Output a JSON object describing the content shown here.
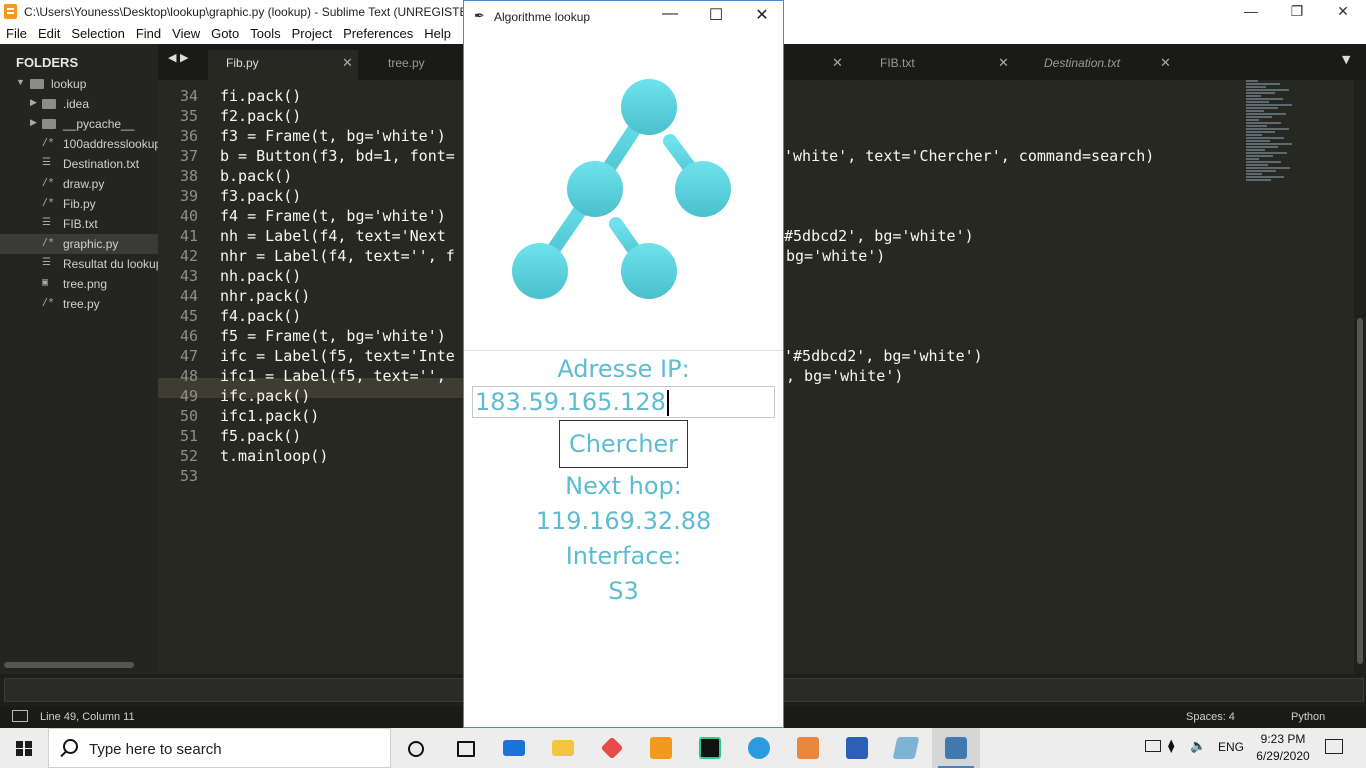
{
  "sublime": {
    "title": "C:\\Users\\Youness\\Desktop\\lookup\\graphic.py (lookup) - Sublime Text (UNREGISTERED)",
    "menu": [
      "File",
      "Edit",
      "Selection",
      "Find",
      "View",
      "Goto",
      "Tools",
      "Project",
      "Preferences",
      "Help"
    ],
    "sidebar_header": "FOLDERS",
    "tree": [
      {
        "label": "lookup",
        "kind": "folder-open"
      },
      {
        "label": ".idea",
        "kind": "folder"
      },
      {
        "label": "__pycache__",
        "kind": "folder"
      },
      {
        "label": "100addresslookup",
        "kind": "code",
        "glyph": "/*"
      },
      {
        "label": "Destination.txt",
        "kind": "text",
        "glyph": "☰"
      },
      {
        "label": "draw.py",
        "kind": "code",
        "glyph": "/*"
      },
      {
        "label": "Fib.py",
        "kind": "code",
        "glyph": "/*"
      },
      {
        "label": "FIB.txt",
        "kind": "text",
        "glyph": "☰"
      },
      {
        "label": "graphic.py",
        "kind": "code",
        "glyph": "/*",
        "selected": true
      },
      {
        "label": "Resultat du lookup",
        "kind": "text",
        "glyph": "☰"
      },
      {
        "label": "tree.png",
        "kind": "image",
        "glyph": "▣"
      },
      {
        "label": "tree.py",
        "kind": "code",
        "glyph": "/*"
      }
    ],
    "tabs": [
      {
        "label": "Fib.py"
      },
      {
        "label": "tree.py"
      },
      {
        "label": "FIB.txt"
      },
      {
        "label": "Destination.txt",
        "italic": true
      }
    ],
    "line_numbers": [
      "34",
      "35",
      "36",
      "37",
      "38",
      "39",
      "40",
      "41",
      "42",
      "43",
      "44",
      "45",
      "46",
      "47",
      "48",
      "49",
      "50",
      "51",
      "52",
      "53"
    ],
    "code": [
      "fi.pack()",
      "f2.pack()",
      "f3 = Frame(t, bg='white')",
      "b = Button(f3, bd=1, font=",
      "b.pack()",
      "f3.pack()",
      "f4 = Frame(t, bg='white')",
      "nh = Label(f4, text='Next",
      "nhr = Label(f4, text='', f",
      "nh.pack()",
      "nhr.pack()",
      "f4.pack()",
      "f5 = Frame(t, bg='white')",
      "ifc = Label(f5, text='Inte",
      "ifc1 = Label(f5, text='', ",
      "ifc.pack()",
      "ifc1.pack()",
      "f5.pack()",
      "t.mainloop()",
      ""
    ],
    "code_right": {
      "37": "'white', text='Chercher', command=search)",
      "41": "#5dbcd2', bg='white')",
      "42": "bg='white')",
      "47": "'#5dbcd2', bg='white')",
      "48": ", bg='white')"
    },
    "status_left": "Line 49, Column 11",
    "status_spaces": "Spaces: 4",
    "status_syntax": "Python"
  },
  "tk": {
    "title": "Algorithme lookup",
    "ip_label": "Adresse IP:",
    "ip_value": "183.59.165.128",
    "button_label": "Chercher",
    "nexthop_label": "Next hop:",
    "nexthop_value": "119.169.32.88",
    "interface_label": "Interface:",
    "interface_value": "S3",
    "accent": "#5dbcd2"
  },
  "taskbar": {
    "search_placeholder": "Type here to search",
    "lang": "ENG",
    "time": "9:23 PM",
    "date": "6/29/2020"
  }
}
